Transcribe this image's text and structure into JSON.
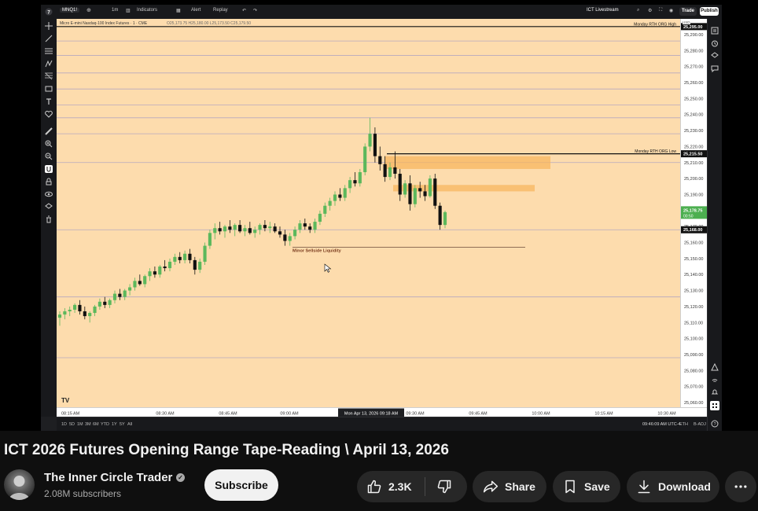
{
  "video": {
    "title": "ICT 2026 Futures Opening Range Tape-Reading \\ April 13, 2026"
  },
  "channel": {
    "name": "The Inner Circle Trader",
    "subscribers": "2.08M subscribers"
  },
  "actions": {
    "subscribe": "Subscribe",
    "likes": "2.3K",
    "share": "Share",
    "save": "Save",
    "download": "Download"
  },
  "tradingview": {
    "symbol": "MNQ1!",
    "timeframe": "1m",
    "indicators": "Indicators",
    "alert": "Alert",
    "replay": "Replay",
    "layout_name": "ICT Livestream",
    "trade": "Trade",
    "publish": "Publish",
    "legend_title": "Micro E-mini Nasdaq-100 Index Futures · 1 · CME",
    "legend_ohlc": "O25,173.75 H25,180.00 L25,173.50 C25,179.50",
    "usd": "USD",
    "range_buttons": [
      "1D",
      "5D",
      "1M",
      "3M",
      "6M",
      "YTD",
      "1Y",
      "5Y",
      "All"
    ],
    "clock": "09:46:09 AM UTC-4",
    "session": "ETH",
    "adj": "B-ADJ"
  },
  "chart_data": {
    "type": "candlestick",
    "instrument": "Micro E-mini Nasdaq-100 Index Futures · 1 · CME",
    "ylim": [
      25056,
      25302
    ],
    "price_ticks": [
      25290,
      25280,
      25270,
      25260,
      25250,
      25240,
      25230,
      25220,
      25210,
      25200,
      25190,
      25180,
      25170,
      25160,
      25150,
      25140,
      25130,
      25120,
      25110,
      25100,
      25090,
      25080,
      25070,
      25060
    ],
    "time_ticks": [
      "08:15 AM",
      "08:30 AM",
      "08:45 AM",
      "09:00 AM",
      "09:30 AM",
      "09:45 AM",
      "10:00 AM",
      "10:15 AM",
      "10:30 AM"
    ],
    "crosshair_time": "Mon Apr 13, 2026   09:18 AM",
    "levels": [
      {
        "label": "Monday RTH ORG High",
        "price": 25295.0,
        "tag": "25,295.00"
      },
      {
        "label": "Monday RTH ORG Low",
        "price": 25215.5,
        "tag": "25,215.50"
      }
    ],
    "last_price": {
      "value": "25,178.75",
      "countdown": "00:50"
    },
    "marker_price": "25,168.00",
    "annotation": "Minor Sellside Liquidity",
    "candles": [
      [
        25113,
        25117,
        25108,
        25115
      ],
      [
        25115,
        25119,
        25112,
        25117
      ],
      [
        25117,
        25120,
        25114,
        25118
      ],
      [
        25118,
        25122,
        25116,
        25121
      ],
      [
        25121,
        25124,
        25115,
        25117
      ],
      [
        25117,
        25120,
        25112,
        25114
      ],
      [
        25114,
        25117,
        25110,
        25116
      ],
      [
        25116,
        25121,
        25114,
        25120
      ],
      [
        25120,
        25125,
        25118,
        25123
      ],
      [
        25123,
        25126,
        25119,
        25121
      ],
      [
        25121,
        25125,
        25119,
        25124
      ],
      [
        25124,
        25130,
        25122,
        25128
      ],
      [
        25128,
        25131,
        25124,
        25126
      ],
      [
        25126,
        25131,
        25124,
        25130
      ],
      [
        25130,
        25134,
        25127,
        25132
      ],
      [
        25132,
        25138,
        25130,
        25136
      ],
      [
        25136,
        25140,
        25133,
        25134
      ],
      [
        25134,
        25140,
        25132,
        25139
      ],
      [
        25139,
        25144,
        25136,
        25142
      ],
      [
        25142,
        25145,
        25138,
        25140
      ],
      [
        25140,
        25146,
        25138,
        25145
      ],
      [
        25145,
        25149,
        25142,
        25144
      ],
      [
        25144,
        25150,
        25142,
        25148
      ],
      [
        25148,
        25153,
        25146,
        25151
      ],
      [
        25151,
        25154,
        25147,
        25149
      ],
      [
        25149,
        25155,
        25147,
        25153
      ],
      [
        25153,
        25156,
        25147,
        25149
      ],
      [
        25149,
        25151,
        25140,
        25143
      ],
      [
        25143,
        25150,
        25141,
        25148
      ],
      [
        25148,
        25160,
        25146,
        25158
      ],
      [
        25158,
        25168,
        25156,
        25166
      ],
      [
        25166,
        25172,
        25162,
        25169
      ],
      [
        25169,
        25173,
        25165,
        25167
      ],
      [
        25167,
        25171,
        25163,
        25170
      ],
      [
        25170,
        25174,
        25166,
        25168
      ],
      [
        25168,
        25172,
        25164,
        25171
      ],
      [
        25171,
        25174,
        25166,
        25167
      ],
      [
        25167,
        25171,
        25164,
        25169
      ],
      [
        25169,
        25173,
        25165,
        25166
      ],
      [
        25166,
        25170,
        25163,
        25168
      ],
      [
        25168,
        25172,
        25165,
        25171
      ],
      [
        25171,
        25174,
        25167,
        25169
      ],
      [
        25169,
        25173,
        25166,
        25170
      ],
      [
        25170,
        25172,
        25166,
        25167
      ],
      [
        25167,
        25170,
        25163,
        25165
      ],
      [
        25165,
        25168,
        25158,
        25161
      ],
      [
        25161,
        25166,
        25158,
        25164
      ],
      [
        25164,
        25170,
        25162,
        25168
      ],
      [
        25168,
        25174,
        25166,
        25172
      ],
      [
        25172,
        25175,
        25168,
        25170
      ],
      [
        25170,
        25172,
        25166,
        25168
      ],
      [
        25168,
        25175,
        25166,
        25173
      ],
      [
        25173,
        25180,
        25171,
        25178
      ],
      [
        25178,
        25185,
        25176,
        25183
      ],
      [
        25183,
        25188,
        25180,
        25186
      ],
      [
        25186,
        25192,
        25183,
        25190
      ],
      [
        25190,
        25194,
        25186,
        25188
      ],
      [
        25188,
        25196,
        25186,
        25194
      ],
      [
        25194,
        25201,
        25191,
        25199
      ],
      [
        25199,
        25204,
        25195,
        25197
      ],
      [
        25197,
        25206,
        25195,
        25204
      ],
      [
        25204,
        25222,
        25202,
        25220
      ],
      [
        25220,
        25238,
        25217,
        25228
      ],
      [
        25228,
        25232,
        25210,
        25214
      ],
      [
        25214,
        25220,
        25205,
        25209
      ],
      [
        25209,
        25214,
        25198,
        25201
      ],
      [
        25201,
        25210,
        25199,
        25207
      ],
      [
        25207,
        25217,
        25200,
        25203
      ],
      [
        25203,
        25206,
        25186,
        25190
      ],
      [
        25190,
        25199,
        25188,
        25197
      ],
      [
        25197,
        25202,
        25180,
        25184
      ],
      [
        25184,
        25196,
        25182,
        25194
      ],
      [
        25194,
        25198,
        25188,
        25192
      ],
      [
        25192,
        25196,
        25186,
        25189
      ],
      [
        25189,
        25202,
        25188,
        25200
      ],
      [
        25200,
        25203,
        25181,
        25183
      ],
      [
        25183,
        25185,
        25168,
        25171
      ],
      [
        25171,
        25180,
        25169,
        25179
      ]
    ]
  }
}
